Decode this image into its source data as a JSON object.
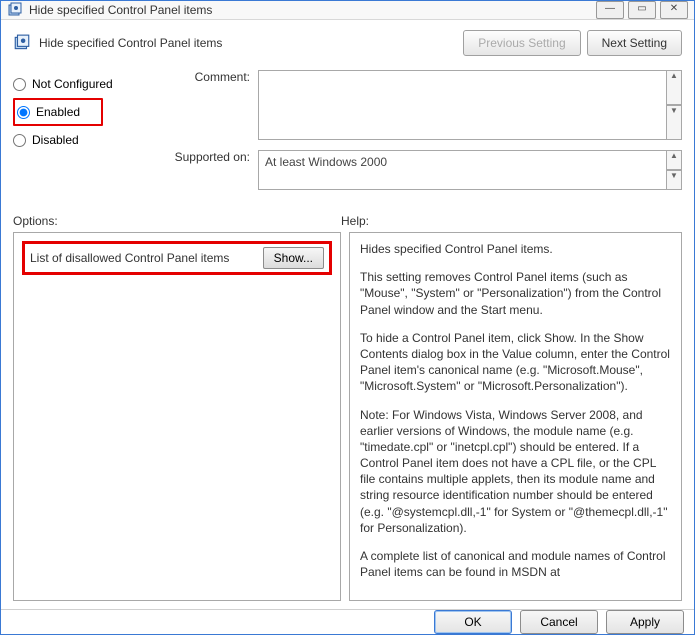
{
  "window": {
    "title": "Hide specified Control Panel items"
  },
  "header": {
    "title": "Hide specified Control Panel items",
    "prev_label": "Previous Setting",
    "next_label": "Next Setting"
  },
  "radios": {
    "not_configured": "Not Configured",
    "enabled": "Enabled",
    "disabled": "Disabled",
    "selected": "enabled"
  },
  "labels": {
    "comment": "Comment:",
    "supported": "Supported on:",
    "options": "Options:",
    "help": "Help:"
  },
  "fields": {
    "comment": "",
    "supported": "At least Windows 2000"
  },
  "options": {
    "item1_label": "List of disallowed Control Panel items",
    "show_btn": "Show..."
  },
  "help": {
    "p1": "Hides specified Control Panel items.",
    "p2": "This setting removes Control Panel items (such as \"Mouse\", \"System\" or \"Personalization\") from the Control Panel window and the Start menu.",
    "p3": "To hide a Control Panel item, click Show. In the Show Contents dialog box in the Value column, enter the Control Panel item's canonical name (e.g. \"Microsoft.Mouse\", \"Microsoft.System\" or \"Microsoft.Personalization\").",
    "p4": "Note: For Windows Vista, Windows Server 2008, and earlier versions of Windows, the module name (e.g. \"timedate.cpl\" or \"inetcpl.cpl\") should be entered. If a Control Panel item does not have a CPL file, or the CPL file contains multiple applets, then its module name and string resource identification number should be entered (e.g. \"@systemcpl.dll,-1\" for System or \"@themecpl.dll,-1\" for Personalization).",
    "p5": "A complete list of canonical and module names of Control Panel items can be found in MSDN at"
  },
  "buttons": {
    "ok": "OK",
    "cancel": "Cancel",
    "apply": "Apply"
  }
}
